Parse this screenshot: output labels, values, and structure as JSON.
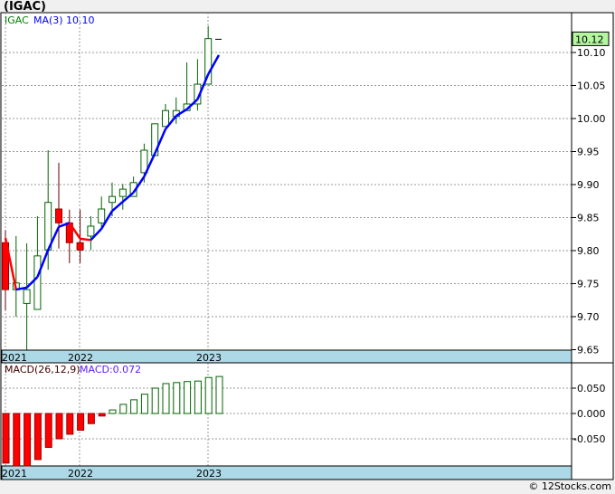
{
  "title": "(IGAC)",
  "footer": "© 12Stocks.com",
  "colors": {
    "up": "#006400",
    "down": "#ff0000",
    "ma": "#0000ff",
    "axis_strip": "#add8e6",
    "price_tag": "#b4f5a0"
  },
  "chart_data": [
    {
      "type": "candlestick",
      "legend": {
        "symbol": "IGAC",
        "ma_label": "MA(3)",
        "ma_value": "10.10"
      },
      "current_price": "10.12",
      "ylim": [
        9.64,
        10.15
      ],
      "yticks": [
        "10.10",
        "10.05",
        "10.00",
        "9.95",
        "9.90",
        "9.85",
        "9.80",
        "9.75",
        "9.70",
        "9.65"
      ],
      "xticks": [
        "2021",
        "2022",
        "2023"
      ],
      "grid": true,
      "candles": [
        {
          "o": 9.812,
          "h": 9.831,
          "l": 9.71,
          "c": 9.741
        },
        {
          "o": 9.741,
          "h": 9.822,
          "l": 9.7,
          "c": 9.751
        },
        {
          "o": 9.72,
          "h": 9.811,
          "l": 9.65,
          "c": 9.741
        },
        {
          "o": 9.711,
          "h": 9.852,
          "l": 9.711,
          "c": 9.792
        },
        {
          "o": 9.801,
          "h": 9.952,
          "l": 9.771,
          "c": 9.873
        },
        {
          "o": 9.863,
          "h": 9.933,
          "l": 9.803,
          "c": 9.842
        },
        {
          "o": 9.842,
          "h": 9.862,
          "l": 9.781,
          "c": 9.812
        },
        {
          "o": 9.812,
          "h": 9.862,
          "l": 9.781,
          "c": 9.801
        },
        {
          "o": 9.822,
          "h": 9.852,
          "l": 9.801,
          "c": 9.837
        },
        {
          "o": 9.842,
          "h": 9.882,
          "l": 9.834,
          "c": 9.863
        },
        {
          "o": 9.873,
          "h": 9.903,
          "l": 9.852,
          "c": 9.882
        },
        {
          "o": 9.882,
          "h": 9.901,
          "l": 9.862,
          "c": 9.893
        },
        {
          "o": 9.882,
          "h": 9.912,
          "l": 9.882,
          "c": 9.903
        },
        {
          "o": 9.918,
          "h": 9.962,
          "l": 9.903,
          "c": 9.952
        },
        {
          "o": 9.944,
          "h": 9.992,
          "l": 9.944,
          "c": 9.992
        },
        {
          "o": 9.988,
          "h": 10.022,
          "l": 9.988,
          "c": 10.012
        },
        {
          "o": 10.003,
          "h": 10.032,
          "l": 9.992,
          "c": 10.012
        },
        {
          "o": 10.012,
          "h": 10.085,
          "l": 10.012,
          "c": 10.022
        },
        {
          "o": 10.022,
          "h": 10.09,
          "l": 10.012,
          "c": 10.052
        },
        {
          "o": 10.052,
          "h": 10.14,
          "l": 10.052,
          "c": 10.121
        }
      ],
      "ma": [
        9.819,
        9.741,
        9.744,
        9.76,
        9.801,
        9.836,
        9.842,
        9.818,
        9.816,
        9.833,
        9.86,
        9.874,
        9.888,
        9.912,
        9.947,
        9.984,
        10.004,
        10.014,
        10.029,
        10.067,
        10.096
      ]
    },
    {
      "type": "bar",
      "legend": {
        "label": "MACD(26,12,9)",
        "value_label": "MACD:0.072"
      },
      "ylim": [
        -0.105,
        0.088
      ],
      "yticks": [
        "0.050",
        "0.000",
        "-0.050"
      ],
      "xticks": [
        "2021",
        "2022",
        "2023"
      ],
      "values": [
        -0.098,
        -0.104,
        -0.104,
        -0.091,
        -0.067,
        -0.05,
        -0.041,
        -0.033,
        -0.02,
        -0.005,
        0.007,
        0.018,
        0.027,
        0.038,
        0.05,
        0.059,
        0.061,
        0.063,
        0.064,
        0.071,
        0.073
      ]
    }
  ]
}
